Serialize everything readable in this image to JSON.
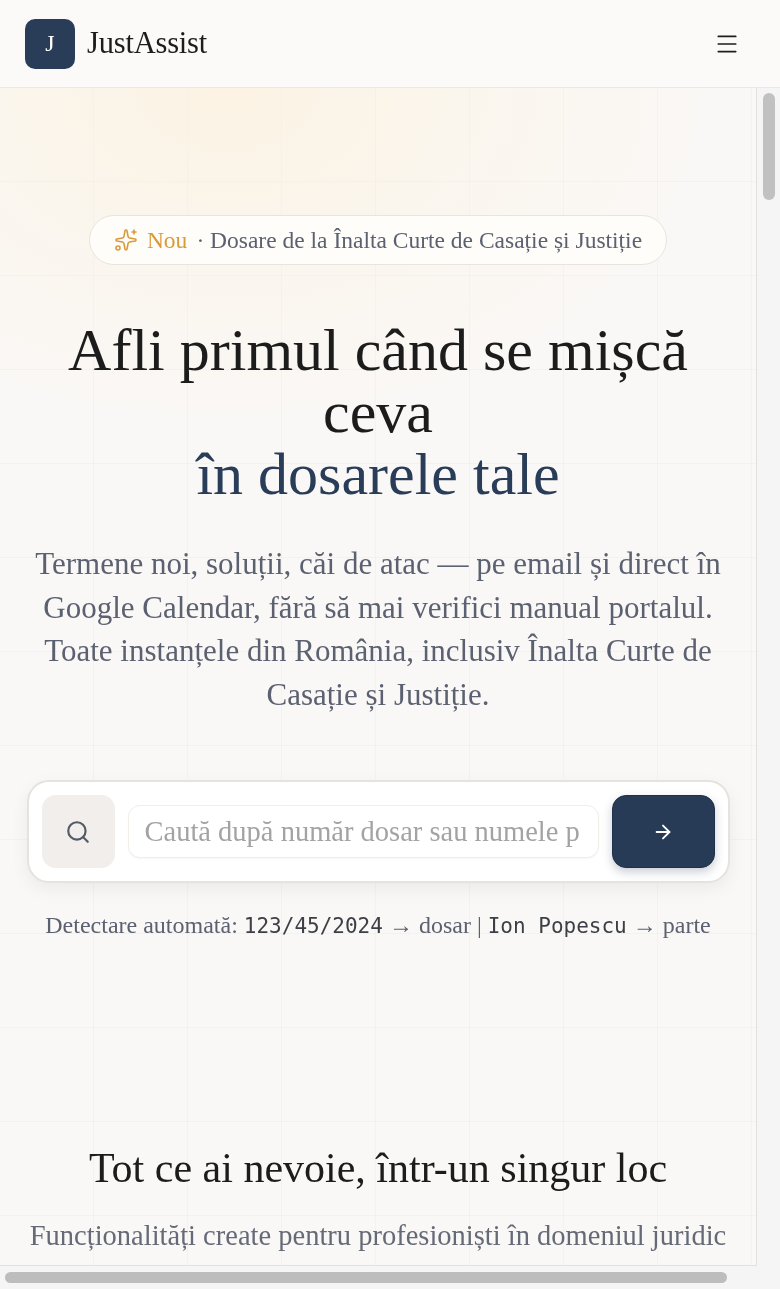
{
  "header": {
    "logo_letter": "J",
    "brand": "JustAssist"
  },
  "hero": {
    "badge": {
      "tag": "Nou",
      "text": "· Dosare de la Înalta Curte de Casație și Justiție"
    },
    "title": {
      "text": "Afli primul când se mișcă ceva",
      "highlight": "în dosarele tale"
    },
    "description": "Termene noi, soluții, căi de atac — pe email și direct în Google Calendar, fără să mai verifici manual portalul. Toate instanțele din România, inclusiv Înalta Curte de Casație și Justiție.",
    "search": {
      "placeholder": "Caută după număr dosar sau numele p"
    },
    "hint": {
      "label": "Detectare automată:",
      "separator": "|",
      "examples": [
        {
          "code": "123/45/2024",
          "arrow": "→",
          "result": "dosar"
        },
        {
          "code": "Ion Popescu",
          "arrow": "→",
          "result": "parte"
        }
      ]
    }
  },
  "features": {
    "title": "Tot ce ai nevoie, într-un singur loc",
    "subtitle": "Funcționalități create pentru profesioniști în domeniul juridic"
  }
}
